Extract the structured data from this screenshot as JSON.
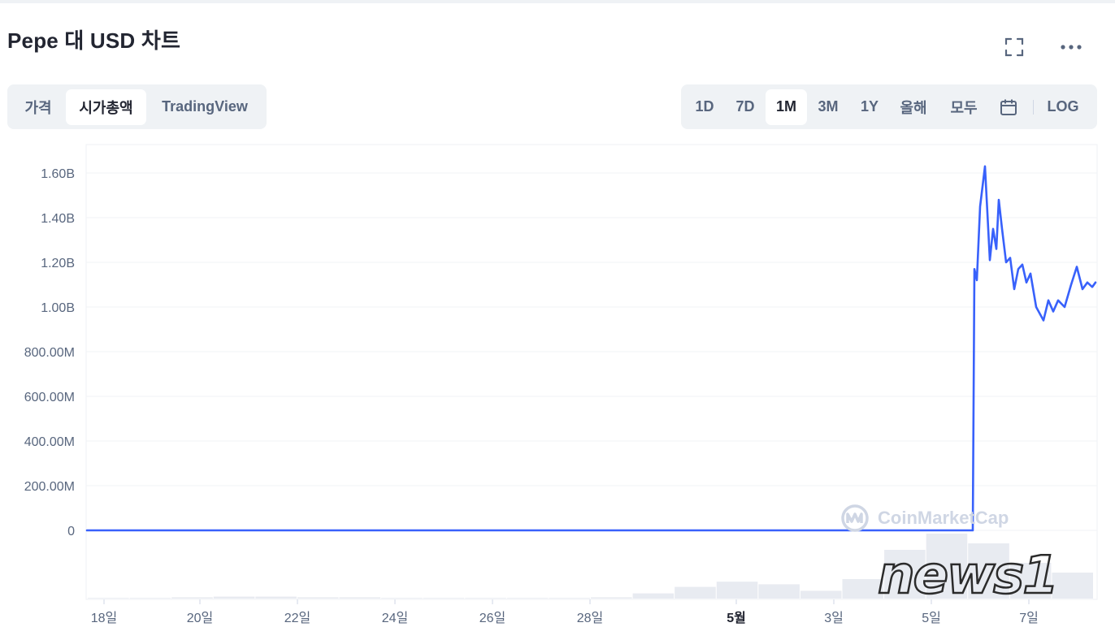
{
  "header": {
    "title": "Pepe 대 USD 차트"
  },
  "icons": {
    "fullscreen": "fullscreen-icon",
    "more": "more-icon",
    "calendar": "calendar-icon"
  },
  "view_tabs": [
    "가격",
    "시가총액",
    "TradingView"
  ],
  "view_tab_active": "시가총액",
  "range_tabs": [
    "1D",
    "7D",
    "1M",
    "3M",
    "1Y",
    "올해",
    "모두"
  ],
  "range_tab_active": "1M",
  "log_label": "LOG",
  "colors": {
    "line": "#3861fb",
    "accent_bg": "#eff2f5",
    "grid": "#eff2f5",
    "axis_text": "#58667e"
  },
  "watermark": {
    "cmc": "CoinMarketCap",
    "news": "news1"
  },
  "chart_data": {
    "type": "line",
    "title": "",
    "xlabel": "",
    "ylabel": "",
    "y_ticks": [
      "1.60B",
      "1.40B",
      "1.20B",
      "1.00B",
      "800.00M",
      "600.00M",
      "400.00M",
      "200.00M",
      "0"
    ],
    "x_ticks": [
      "18일",
      "20일",
      "22일",
      "24일",
      "26일",
      "28일",
      "5월",
      "3일",
      "5일",
      "7일"
    ],
    "ylim": [
      0,
      1600000000
    ],
    "grid": true,
    "legend": "none",
    "series": [
      {
        "values": [
          [
            "18일",
            0
          ],
          [
            "19일",
            0
          ],
          [
            "20일",
            0
          ],
          [
            "21일",
            0
          ],
          [
            "22일",
            0
          ],
          [
            "23일",
            0
          ],
          [
            "24일",
            0
          ],
          [
            "25일",
            0
          ],
          [
            "26일",
            0
          ],
          [
            "27일",
            0
          ],
          [
            "28일",
            0
          ],
          [
            "29일",
            0
          ],
          [
            "30일",
            0
          ],
          [
            "5월",
            0
          ],
          [
            "2일",
            0
          ],
          [
            "3일",
            0
          ],
          [
            "4일",
            0
          ],
          [
            "5일",
            0
          ],
          [
            "5일 12시",
            0
          ],
          [
            "5일 16시",
            1170000000
          ],
          [
            "5일 17시",
            1120000000
          ],
          [
            "5일 20시",
            1450000000
          ],
          [
            "6일 0시",
            1630000000
          ],
          [
            "6일 2시",
            1420000000
          ],
          [
            "6일 4시",
            1210000000
          ],
          [
            "6일 6시",
            1350000000
          ],
          [
            "6일 8시",
            1260000000
          ],
          [
            "6일 10시",
            1480000000
          ],
          [
            "6일 12시",
            1350000000
          ],
          [
            "6일 14시",
            1200000000
          ],
          [
            "6일 16시",
            1220000000
          ],
          [
            "6일 18시",
            1080000000
          ],
          [
            "6일 20시",
            1170000000
          ],
          [
            "6일 22시",
            1190000000
          ],
          [
            "7일 0시",
            1110000000
          ],
          [
            "7일 2시",
            1150000000
          ],
          [
            "7일 4시",
            1000000000
          ],
          [
            "7일 6시",
            940000000
          ],
          [
            "7일 8시",
            1030000000
          ],
          [
            "7일 10시",
            980000000
          ],
          [
            "7일 12시",
            1030000000
          ],
          [
            "7일 14시",
            1000000000
          ],
          [
            "7일 16시",
            1100000000
          ],
          [
            "7일 18시",
            1180000000
          ],
          [
            "7일 20시",
            1080000000
          ],
          [
            "7일 22시",
            1110000000
          ],
          [
            "8일 0시",
            1090000000
          ],
          [
            "8일 1시",
            1110000000
          ]
        ]
      }
    ],
    "volume_series": [
      0.01,
      0.01,
      0.02,
      0.03,
      0.03,
      0.02,
      0.02,
      0.01,
      0.01,
      0.01,
      0.01,
      0.01,
      0.02,
      0.08,
      0.18,
      0.26,
      0.22,
      0.12,
      0.3,
      0.75,
      1.0,
      0.85,
      0.55,
      0.4
    ]
  }
}
